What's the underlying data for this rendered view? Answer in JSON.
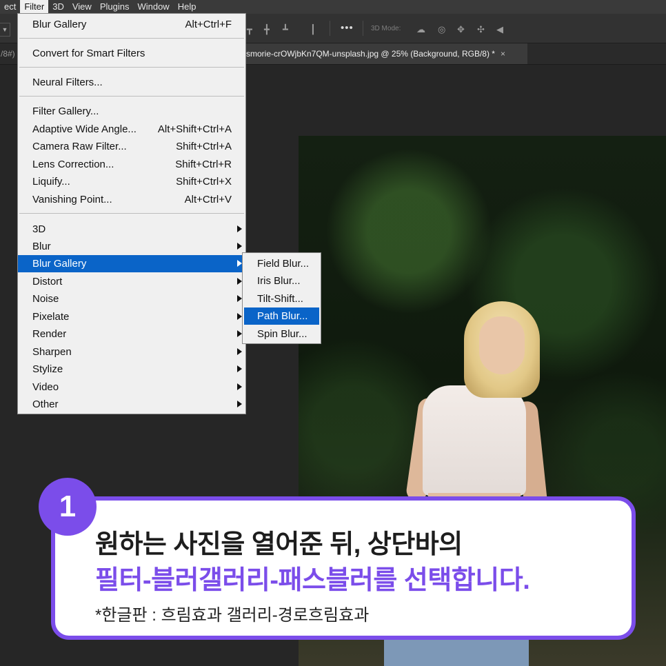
{
  "menubar": {
    "items": [
      "ect",
      "Filter",
      "3D",
      "View",
      "Plugins",
      "Window",
      "Help"
    ],
    "active_index": 1
  },
  "optbar": {
    "more_label": "•••",
    "mode_3d_label": "3D Mode:"
  },
  "tabs": {
    "left_fragment": "/8#)",
    "active": "smorie-crOWjbKn7QM-unsplash.jpg @ 25% (Background, RGB/8) *",
    "close_glyph": "×"
  },
  "filter_menu": {
    "last_filter": {
      "label": "Blur Gallery",
      "shortcut": "Alt+Ctrl+F"
    },
    "smart": {
      "label": "Convert for Smart Filters"
    },
    "neural": {
      "label": "Neural Filters..."
    },
    "gallery_group": [
      {
        "label": "Filter Gallery...",
        "shortcut": ""
      },
      {
        "label": "Adaptive Wide Angle...",
        "shortcut": "Alt+Shift+Ctrl+A"
      },
      {
        "label": "Camera Raw Filter...",
        "shortcut": "Shift+Ctrl+A"
      },
      {
        "label": "Lens Correction...",
        "shortcut": "Shift+Ctrl+R"
      },
      {
        "label": "Liquify...",
        "shortcut": "Shift+Ctrl+X"
      },
      {
        "label": "Vanishing Point...",
        "shortcut": "Alt+Ctrl+V"
      }
    ],
    "submenus": [
      {
        "label": "3D"
      },
      {
        "label": "Blur"
      },
      {
        "label": "Blur Gallery"
      },
      {
        "label": "Distort"
      },
      {
        "label": "Noise"
      },
      {
        "label": "Pixelate"
      },
      {
        "label": "Render"
      },
      {
        "label": "Sharpen"
      },
      {
        "label": "Stylize"
      },
      {
        "label": "Video"
      },
      {
        "label": "Other"
      }
    ],
    "highlighted": "Blur Gallery"
  },
  "blur_gallery_submenu": {
    "items": [
      "Field Blur...",
      "Iris Blur...",
      "Tilt-Shift...",
      "Path Blur...",
      "Spin Blur..."
    ],
    "highlighted": "Path Blur..."
  },
  "callout": {
    "step": "1",
    "line1": "원하는 사진을 열어준 뒤, 상단바의",
    "line2": "필터-블러갤러리-패스블러를 선택합니다.",
    "note": "*한글판 : 흐림효과 갤러리-경로흐림효과",
    "accent_color": "#7b4dea"
  },
  "colors": {
    "menu_highlight": "#0a64c8",
    "workspace": "#262626"
  }
}
